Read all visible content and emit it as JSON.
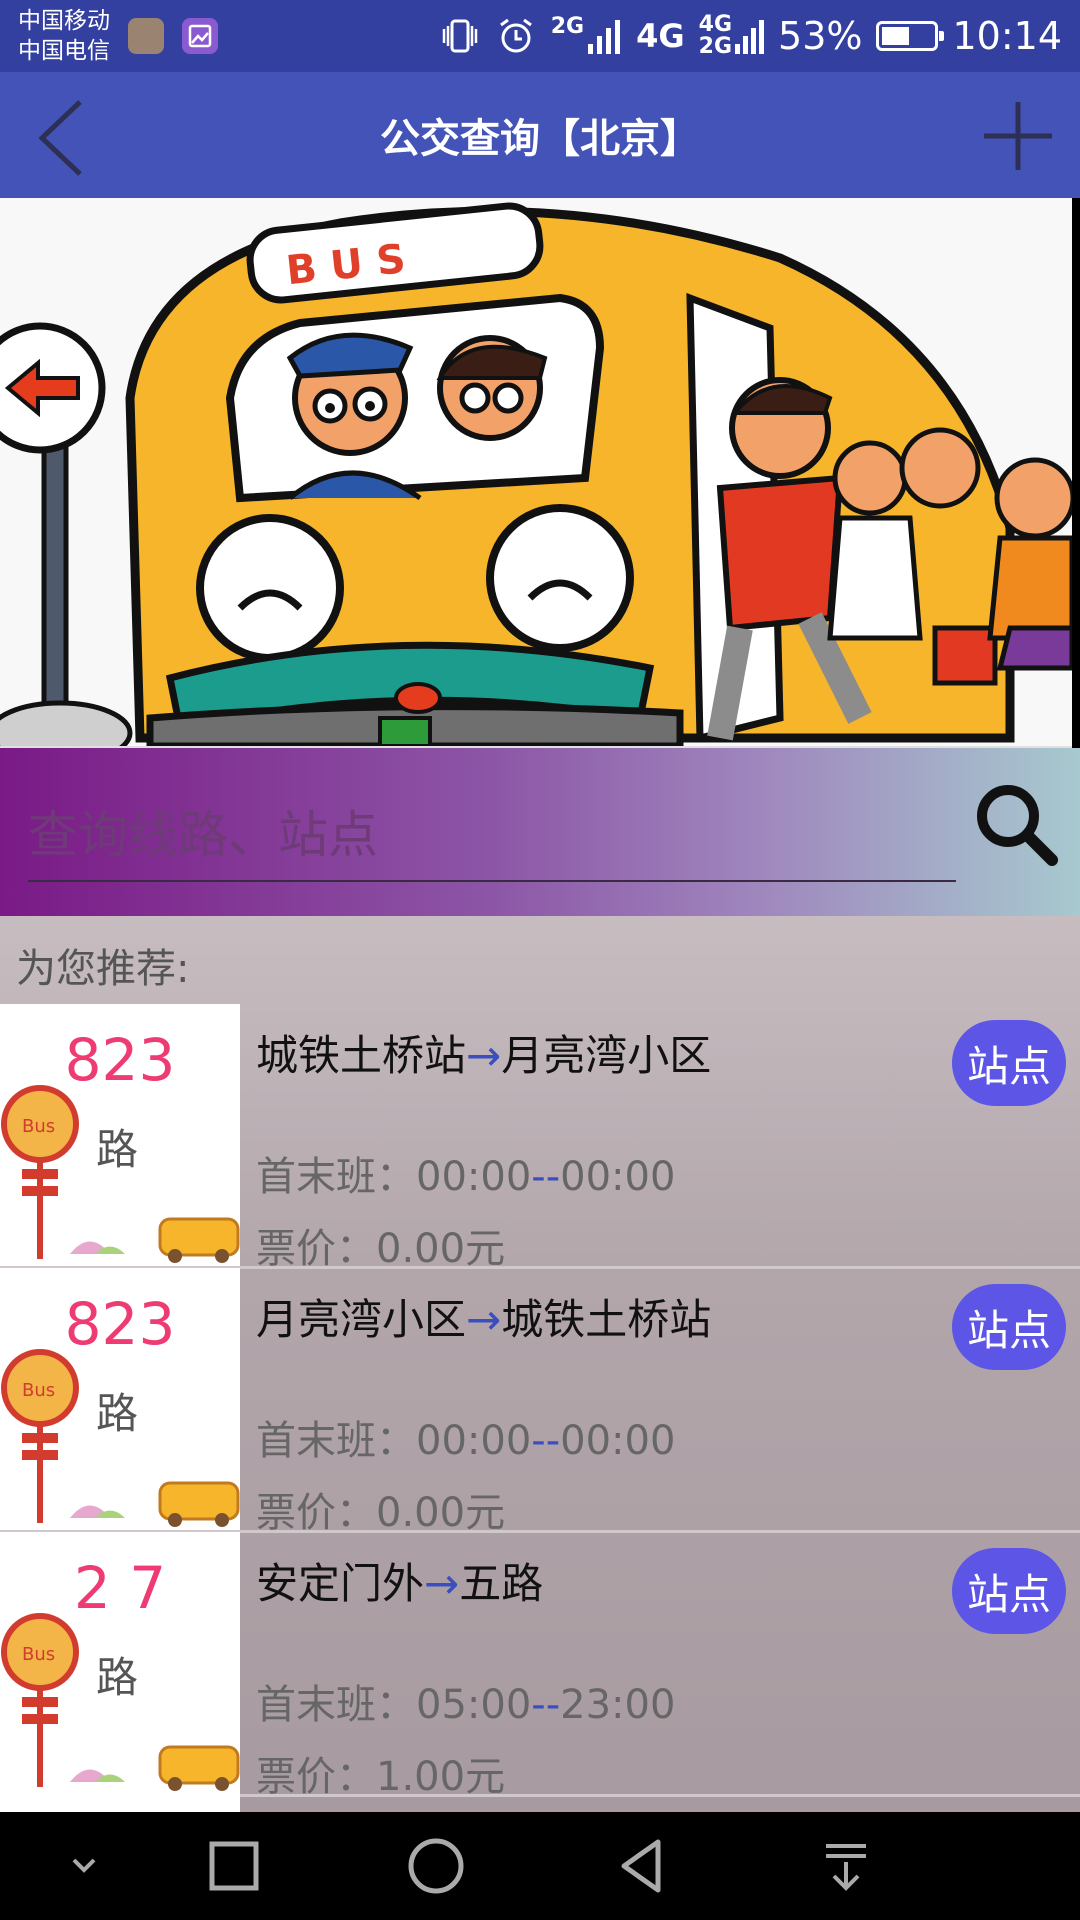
{
  "status_bar": {
    "carrier_1": "中国移动",
    "carrier_2": "中国电信",
    "network_1": "2G",
    "network_2": "4G",
    "network_3_top": "4G",
    "network_3_bottom": "2G",
    "battery_percent": "53%",
    "battery_level": 0.53,
    "time": "10:14"
  },
  "app_bar": {
    "title": "公交查询【北京】",
    "back_icon": "chevron-left-icon",
    "add_icon": "plus-icon"
  },
  "banner": {
    "sign_text": "B U S"
  },
  "search": {
    "placeholder": "查询线路、站点",
    "icon": "search-icon"
  },
  "recommend": {
    "label": "为您推荐:",
    "routes": [
      {
        "number": "823",
        "suffix": "路",
        "from": "城铁土桥站",
        "arrow": "→",
        "to": "月亮湾小区",
        "time_label": "首末班：",
        "first": "00:00",
        "dash": "--",
        "last": "00:00",
        "price_label": "票价：",
        "price": "0.00元",
        "button": "站点"
      },
      {
        "number": "823",
        "suffix": "路",
        "from": "月亮湾小区",
        "arrow": "→",
        "to": "城铁土桥站",
        "time_label": "首末班：",
        "first": "00:00",
        "dash": "--",
        "last": "00:00",
        "price_label": "票价：",
        "price": "0.00元",
        "button": "站点"
      },
      {
        "number": "2 7",
        "suffix": "路",
        "from": "安定门外",
        "arrow": "→",
        "to": "五路",
        "time_label": "首末班：",
        "first": "05:00",
        "dash": "--",
        "last": "23:00",
        "price_label": "票价：",
        "price": "1.00元",
        "button": "站点"
      }
    ]
  },
  "nav_bar": {
    "buttons": [
      "chevron-down-icon",
      "recent-apps-icon",
      "home-icon",
      "back-icon",
      "notification-pull-icon"
    ]
  },
  "colors": {
    "status_bar": "#3340a0",
    "app_bar": "#4353b7",
    "route_number": "#ee3c73",
    "station_button": "#5c55e6",
    "arrow": "#3a4ec0"
  }
}
